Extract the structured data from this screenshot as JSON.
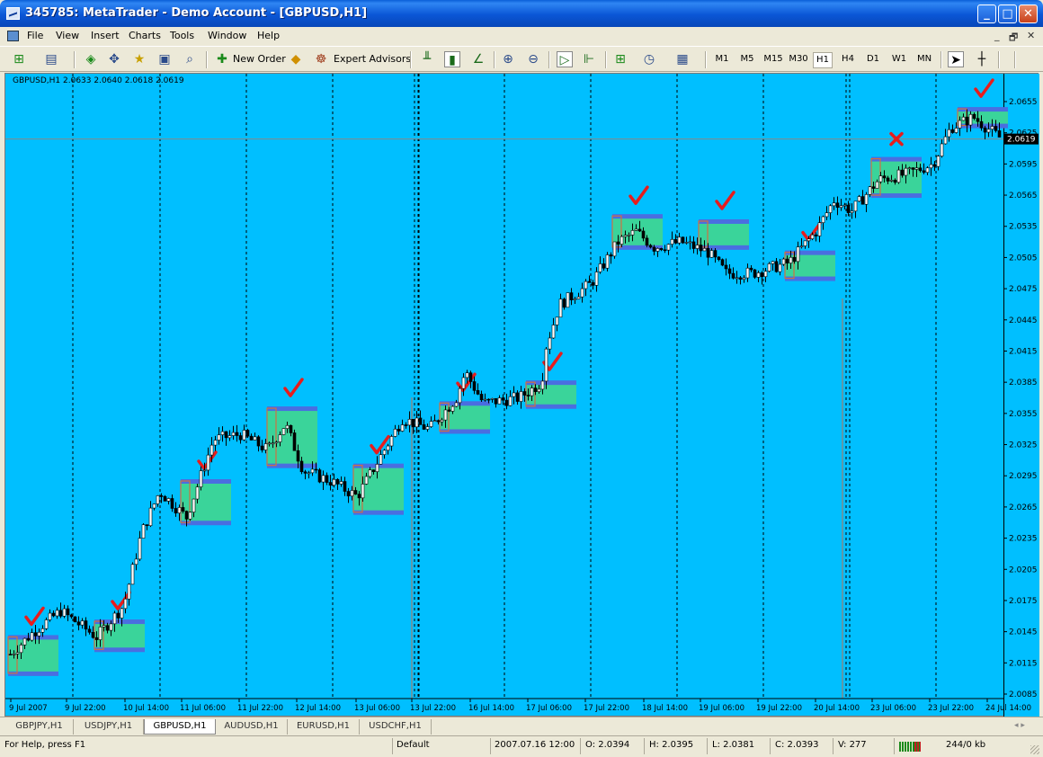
{
  "window": {
    "title": "345785: MetaTrader - Demo Account - [GBPUSD,H1]",
    "min": "_",
    "max": "□",
    "close": "✕"
  },
  "menu": {
    "items": [
      "File",
      "View",
      "Insert",
      "Charts",
      "Tools",
      "Window",
      "Help"
    ],
    "mdi": [
      "_",
      "🗗",
      "✕"
    ]
  },
  "toolbar": {
    "new_order": "New Order",
    "expert_advisors": "Expert Advisors",
    "timeframes": [
      "M1",
      "M5",
      "M15",
      "M30",
      "H1",
      "H4",
      "D1",
      "W1",
      "MN"
    ],
    "active_timeframe": "H1",
    "icons": [
      "new-chart",
      "profiles",
      "market-watch",
      "navigator",
      "favorites",
      "terminal",
      "strategy-tester",
      "new-order",
      "metaeditor",
      "expert-advisors",
      "bar-chart",
      "candlesticks",
      "line-chart",
      "zoom-in",
      "zoom-out",
      "auto-scroll",
      "chart-shift",
      "indicators",
      "periods",
      "templates",
      "cursor",
      "crosshair"
    ]
  },
  "chart": {
    "info": "GBPUSD,H1  2.0633 2.0640 2.0618 2.0619",
    "colors": {
      "background": "#00bfff",
      "box_fill": "#3ad49a",
      "box_edge": "#4a6ee0",
      "box_open": "#d07040",
      "check": "#e81c1c",
      "candle": "#000000"
    },
    "current_price": "2.0619",
    "price_labels": [
      "2.0655",
      "2.0625",
      "2.0595",
      "2.0565",
      "2.0535",
      "2.0505",
      "2.0475",
      "2.0445",
      "2.0415",
      "2.0385",
      "2.0355",
      "2.0325",
      "2.0295",
      "2.0265",
      "2.0235",
      "2.0205",
      "2.0175",
      "2.0145",
      "2.0115",
      "2.0085"
    ],
    "time_labels": [
      "9 Jul 2007",
      "9 Jul 22:00",
      "10 Jul 14:00",
      "11 Jul 06:00",
      "11 Jul 22:00",
      "12 Jul 14:00",
      "13 Jul 06:00",
      "13 Jul 22:00",
      "16 Jul 14:00",
      "17 Jul 06:00",
      "17 Jul 22:00",
      "18 Jul 14:00",
      "19 Jul 06:00",
      "19 Jul 22:00",
      "20 Jul 14:00",
      "23 Jul 06:00",
      "23 Jul 22:00",
      "24 Jul 14:00"
    ],
    "boxes": [
      {
        "open": 2.0133,
        "lo": 2.0105,
        "hi": 2.014,
        "result": "win"
      },
      {
        "open": 2.0138,
        "lo": 2.0128,
        "hi": 2.0155,
        "result": "win"
      },
      {
        "open": 2.027,
        "lo": 2.025,
        "hi": 2.029,
        "result": "win"
      },
      {
        "open": 2.0305,
        "lo": 2.0305,
        "hi": 2.036,
        "result": "win"
      },
      {
        "open": 2.026,
        "lo": 2.026,
        "hi": 2.0305,
        "result": "win"
      },
      {
        "open": 2.0338,
        "lo": 2.0338,
        "hi": 2.0365,
        "result": "win"
      },
      {
        "open": 2.0362,
        "lo": 2.0362,
        "hi": 2.0385,
        "result": "win"
      },
      {
        "open": 2.0515,
        "lo": 2.0515,
        "hi": 2.0545,
        "result": "win"
      },
      {
        "open": 2.0515,
        "lo": 2.0515,
        "hi": 2.054,
        "result": "win"
      },
      {
        "open": 2.0485,
        "lo": 2.0485,
        "hi": 2.051,
        "result": "win"
      },
      {
        "open": 2.059,
        "lo": 2.0565,
        "hi": 2.06,
        "result": "loss"
      },
      {
        "open": 2.0632,
        "lo": 2.0632,
        "hi": 2.0648,
        "result": "win"
      }
    ]
  },
  "tabs": {
    "items": [
      "GBPJPY,H1",
      "USDJPY,H1",
      "GBPUSD,H1",
      "AUDUSD,H1",
      "EURUSD,H1",
      "USDCHF,H1"
    ],
    "active": "GBPUSD,H1",
    "scroll": "◂ ▸"
  },
  "status": {
    "help": "For Help, press F1",
    "profile": "Default",
    "datetime": "2007.07.16 12:00",
    "open": "O: 2.0394",
    "high": "H: 2.0395",
    "low": "L: 2.0381",
    "close": "C: 2.0393",
    "volume": "V: 277",
    "traffic": "244/0 kb"
  }
}
